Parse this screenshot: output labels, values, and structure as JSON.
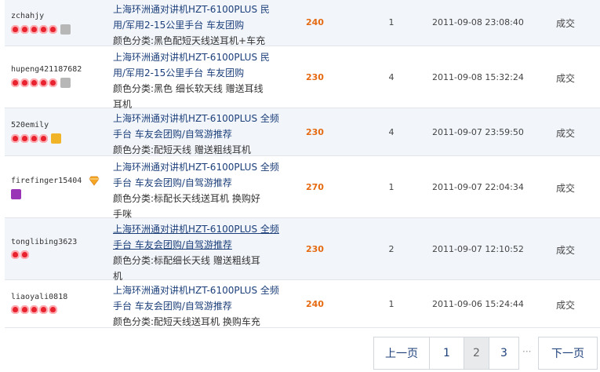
{
  "rows": [
    {
      "buyer": "zchahjy",
      "hearts": 5,
      "badge": "gray",
      "title": [
        "上海环洲通对讲机HZT-6100PLUS 民",
        "用/军用2-15公里手台 车友团购"
      ],
      "sku": [
        "颜色分类:黑色配短天线送耳机+车充"
      ],
      "price": "240",
      "qty": "1",
      "date": "2011-09-08 23:08:40",
      "status": "成交"
    },
    {
      "buyer": "hupeng421187682",
      "hearts": 5,
      "badge": "gray",
      "title": [
        "上海环洲通对讲机HZT-6100PLUS 民",
        "用/军用2-15公里手台 车友团购"
      ],
      "sku": [
        "颜色分类:黑色 细长软天线 赠送耳线",
        "耳机"
      ],
      "price": "230",
      "qty": "4",
      "date": "2011-09-08 15:32:24",
      "status": "成交"
    },
    {
      "buyer": "520emily",
      "hearts": 4,
      "badge": "gold",
      "title": [
        "上海环洲通对讲机HZT-6100PLUS 全频",
        "手台 车友会团购/自驾游推荐"
      ],
      "sku": [
        "颜色分类:配短天线 赠送粗线耳机"
      ],
      "price": "230",
      "qty": "4",
      "date": "2011-09-07 23:59:50",
      "status": "成交"
    },
    {
      "buyer": "firefinger15404",
      "hearts": 0,
      "badge": "purple",
      "title": [
        "上海环洲通对讲机HZT-6100PLUS 全频",
        "手台 车友会团购/自驾游推荐"
      ],
      "sku": [
        "颜色分类:标配长天线送耳机 换购好",
        "手咪"
      ],
      "price": "270",
      "qty": "1",
      "date": "2011-09-07 22:04:34",
      "status": "成交"
    },
    {
      "buyer": "tonglibing3623",
      "hearts": 2,
      "badge": "",
      "title": [
        "上海环洲通对讲机HZT-6100PLUS 全频",
        "手台 车友会团购/自驾游推荐"
      ],
      "sku": [
        "颜色分类:标配细长天线 赠送粗线耳",
        "机"
      ],
      "price": "230",
      "qty": "2",
      "date": "2011-09-07 12:10:52",
      "status": "成交"
    },
    {
      "buyer": "liaoyali0818",
      "hearts": 5,
      "badge": "",
      "title": [
        "上海环洲通对讲机HZT-6100PLUS 全频",
        "手台 车友会团购/自驾游推荐"
      ],
      "sku": [
        "颜色分类:配短天线送耳机 换购车充"
      ],
      "price": "240",
      "qty": "1",
      "date": "2011-09-06 15:24:44",
      "status": "成交"
    }
  ],
  "pager": {
    "prev": "上一页",
    "p1": "1",
    "p2": "2",
    "p3": "3",
    "ellipsis": "···",
    "next": "下一页"
  },
  "colors": {
    "price": "#e56a12",
    "link": "#1c3f7a",
    "heart": "#e8232f",
    "row_alt": "#f2f6fb"
  }
}
